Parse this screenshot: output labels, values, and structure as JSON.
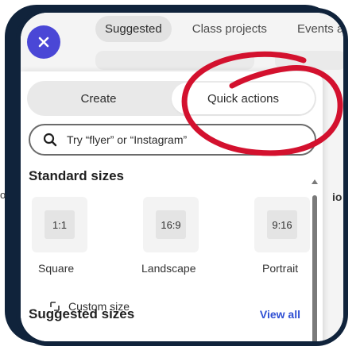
{
  "top_tabs": [
    {
      "label": "Suggested",
      "active": true
    },
    {
      "label": "Class projects",
      "active": false
    },
    {
      "label": "Events a",
      "active": false
    }
  ],
  "panel": {
    "segments": [
      {
        "label": "Create",
        "active": true
      },
      {
        "label": "Quick actions",
        "active": false
      }
    ],
    "search": {
      "placeholder": "Try “flyer” or “Instagram”"
    },
    "standard_sizes": {
      "title": "Standard sizes",
      "items": [
        {
          "ratio": "1:1",
          "label": "Square"
        },
        {
          "ratio": "16:9",
          "label": "Landscape"
        },
        {
          "ratio": "9:16",
          "label": "Portrait"
        }
      ]
    },
    "suggested_sizes": {
      "title": "Suggested sizes",
      "view_all": "View all"
    },
    "custom_size": "Custom size"
  },
  "background": {
    "side_text": "io",
    "outside_text": "o"
  },
  "colors": {
    "frame": "#10233b",
    "close_button": "#4a47d6",
    "annotation": "#d3112e",
    "link": "#2f4fd3"
  }
}
